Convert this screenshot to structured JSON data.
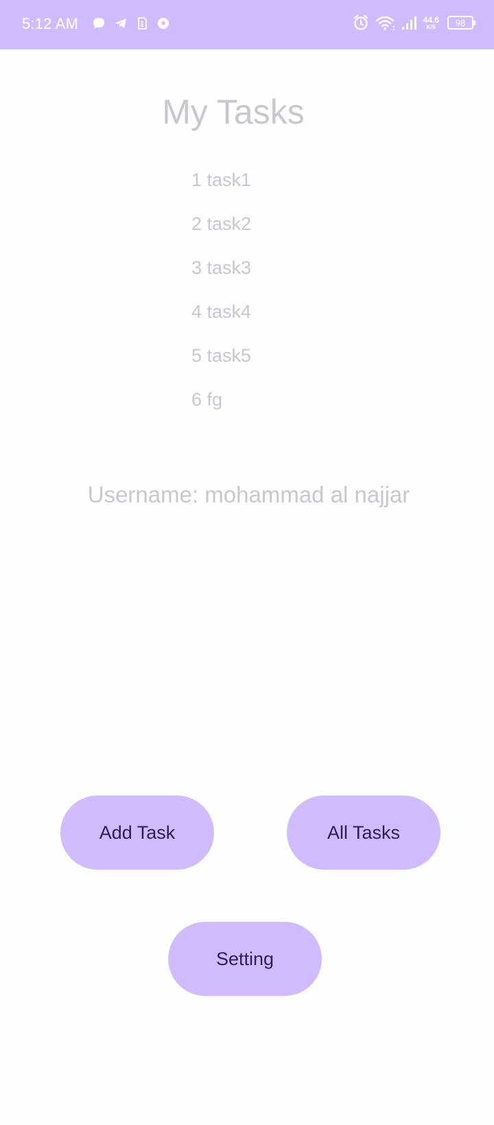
{
  "status_bar": {
    "time": "5:12 AM",
    "net_speed_value": "44.6",
    "net_speed_unit": "K/S",
    "battery_level": "98",
    "background_color": "#d0bcfd",
    "notification_icons": [
      "chat-bubble-icon",
      "telegram-icon",
      "sim-icon",
      "soccer-ball-icon"
    ],
    "system_icons": [
      "alarm-icon",
      "wifi-icon",
      "signal-icon"
    ]
  },
  "header": {
    "title": "My Tasks"
  },
  "tasks": [
    {
      "number": "1",
      "name": "task1",
      "text": "1 task1"
    },
    {
      "number": "2",
      "name": "task2",
      "text": "2 task2"
    },
    {
      "number": "3",
      "name": "task3",
      "text": "3 task3"
    },
    {
      "number": "4",
      "name": "task4",
      "text": "4 task4"
    },
    {
      "number": "5",
      "name": "task5",
      "text": "5 task5"
    },
    {
      "number": "6",
      "name": "fg",
      "text": "6 fg"
    }
  ],
  "user": {
    "username_label": "Username: mohammad al najjar"
  },
  "actions": {
    "add_task_label": "Add Task",
    "all_tasks_label": "All Tasks",
    "setting_label": "Setting"
  },
  "colors": {
    "accent": "#d0bcfd",
    "button_text": "#2e1a5e",
    "muted_text": "#c8c7d1",
    "background": "#fefefe"
  }
}
